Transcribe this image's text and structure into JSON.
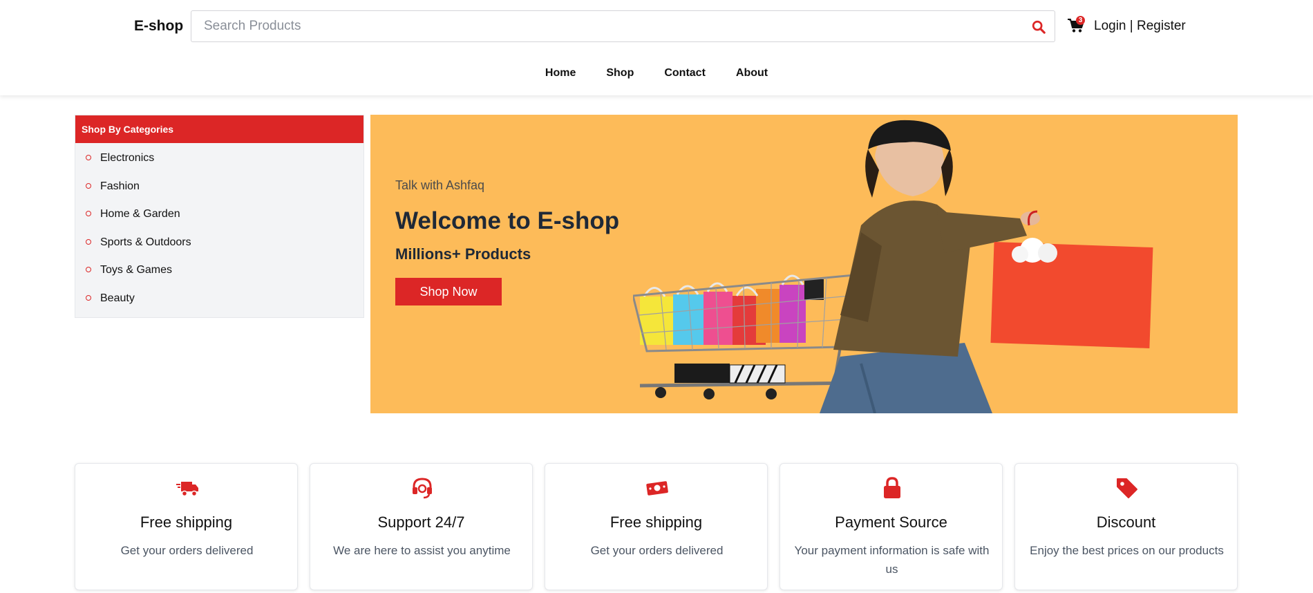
{
  "header": {
    "logo": "E-shop",
    "search_placeholder": "Search Products",
    "cart_count": "3",
    "login": "Login",
    "separator": " | ",
    "register": "Register"
  },
  "nav": [
    "Home",
    "Shop",
    "Contact",
    "About"
  ],
  "sidebar": {
    "title": "Shop By Categories",
    "items": [
      "Electronics",
      "Fashion",
      "Home & Garden",
      "Sports & Outdoors",
      "Toys & Games",
      "Beauty"
    ]
  },
  "hero": {
    "kicker": "Talk with Ashfaq",
    "title": "Welcome to E-shop",
    "subtitle": "Millions+ Products",
    "button": "Shop Now"
  },
  "features": [
    {
      "icon": "truck-icon",
      "title": "Free shipping",
      "text": "Get your orders delivered"
    },
    {
      "icon": "headset-icon",
      "title": "Support 24/7",
      "text": "We are here to assist you anytime"
    },
    {
      "icon": "money-icon",
      "title": "Free shipping",
      "text": "Get your orders delivered"
    },
    {
      "icon": "lock-icon",
      "title": "Payment Source",
      "text": "Your payment information is safe with us"
    },
    {
      "icon": "tag-icon",
      "title": "Discount",
      "text": "Enjoy the best prices on our products"
    }
  ],
  "colors": {
    "accent": "#dc2626",
    "hero_bg": "#fdbb59",
    "sidebar_bg": "#f3f4f6"
  }
}
